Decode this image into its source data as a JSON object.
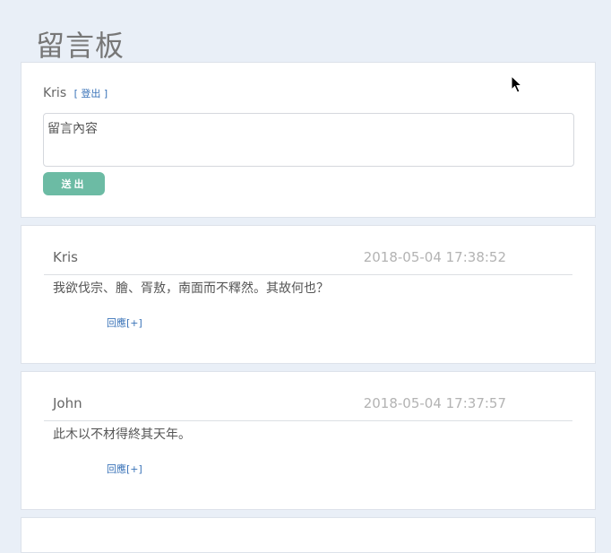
{
  "page": {
    "title": "留言板"
  },
  "compose": {
    "username": "Kris",
    "logout_label": "[ 登出 ]",
    "placeholder": "留言內容",
    "submit_label": "送出"
  },
  "comments": [
    {
      "author": "Kris",
      "timestamp": "2018-05-04 17:38:52",
      "content": "我欲伐宗、膾、胥敖，南面而不釋然。其故何也？",
      "reply_label": "回應[+]"
    },
    {
      "author": "John",
      "timestamp": "2018-05-04 17:37:57",
      "content": "此木以不材得終其天年。",
      "reply_label": "回應[+]"
    }
  ],
  "colors": {
    "background": "#e9eff7",
    "submit_button": "#6cbba4",
    "link": "#3a73b8"
  }
}
